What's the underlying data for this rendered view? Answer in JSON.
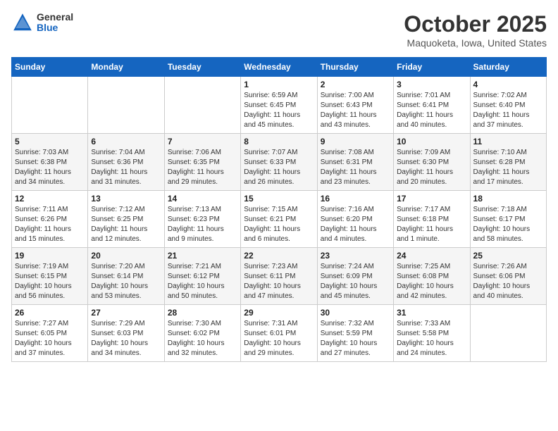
{
  "header": {
    "logo_general": "General",
    "logo_blue": "Blue",
    "month_title": "October 2025",
    "location": "Maquoketa, Iowa, United States"
  },
  "days_of_week": [
    "Sunday",
    "Monday",
    "Tuesday",
    "Wednesday",
    "Thursday",
    "Friday",
    "Saturday"
  ],
  "weeks": [
    [
      {
        "day": "",
        "info": ""
      },
      {
        "day": "",
        "info": ""
      },
      {
        "day": "",
        "info": ""
      },
      {
        "day": "1",
        "info": "Sunrise: 6:59 AM\nSunset: 6:45 PM\nDaylight: 11 hours\nand 45 minutes."
      },
      {
        "day": "2",
        "info": "Sunrise: 7:00 AM\nSunset: 6:43 PM\nDaylight: 11 hours\nand 43 minutes."
      },
      {
        "day": "3",
        "info": "Sunrise: 7:01 AM\nSunset: 6:41 PM\nDaylight: 11 hours\nand 40 minutes."
      },
      {
        "day": "4",
        "info": "Sunrise: 7:02 AM\nSunset: 6:40 PM\nDaylight: 11 hours\nand 37 minutes."
      }
    ],
    [
      {
        "day": "5",
        "info": "Sunrise: 7:03 AM\nSunset: 6:38 PM\nDaylight: 11 hours\nand 34 minutes."
      },
      {
        "day": "6",
        "info": "Sunrise: 7:04 AM\nSunset: 6:36 PM\nDaylight: 11 hours\nand 31 minutes."
      },
      {
        "day": "7",
        "info": "Sunrise: 7:06 AM\nSunset: 6:35 PM\nDaylight: 11 hours\nand 29 minutes."
      },
      {
        "day": "8",
        "info": "Sunrise: 7:07 AM\nSunset: 6:33 PM\nDaylight: 11 hours\nand 26 minutes."
      },
      {
        "day": "9",
        "info": "Sunrise: 7:08 AM\nSunset: 6:31 PM\nDaylight: 11 hours\nand 23 minutes."
      },
      {
        "day": "10",
        "info": "Sunrise: 7:09 AM\nSunset: 6:30 PM\nDaylight: 11 hours\nand 20 minutes."
      },
      {
        "day": "11",
        "info": "Sunrise: 7:10 AM\nSunset: 6:28 PM\nDaylight: 11 hours\nand 17 minutes."
      }
    ],
    [
      {
        "day": "12",
        "info": "Sunrise: 7:11 AM\nSunset: 6:26 PM\nDaylight: 11 hours\nand 15 minutes."
      },
      {
        "day": "13",
        "info": "Sunrise: 7:12 AM\nSunset: 6:25 PM\nDaylight: 11 hours\nand 12 minutes."
      },
      {
        "day": "14",
        "info": "Sunrise: 7:13 AM\nSunset: 6:23 PM\nDaylight: 11 hours\nand 9 minutes."
      },
      {
        "day": "15",
        "info": "Sunrise: 7:15 AM\nSunset: 6:21 PM\nDaylight: 11 hours\nand 6 minutes."
      },
      {
        "day": "16",
        "info": "Sunrise: 7:16 AM\nSunset: 6:20 PM\nDaylight: 11 hours\nand 4 minutes."
      },
      {
        "day": "17",
        "info": "Sunrise: 7:17 AM\nSunset: 6:18 PM\nDaylight: 11 hours\nand 1 minute."
      },
      {
        "day": "18",
        "info": "Sunrise: 7:18 AM\nSunset: 6:17 PM\nDaylight: 10 hours\nand 58 minutes."
      }
    ],
    [
      {
        "day": "19",
        "info": "Sunrise: 7:19 AM\nSunset: 6:15 PM\nDaylight: 10 hours\nand 56 minutes."
      },
      {
        "day": "20",
        "info": "Sunrise: 7:20 AM\nSunset: 6:14 PM\nDaylight: 10 hours\nand 53 minutes."
      },
      {
        "day": "21",
        "info": "Sunrise: 7:21 AM\nSunset: 6:12 PM\nDaylight: 10 hours\nand 50 minutes."
      },
      {
        "day": "22",
        "info": "Sunrise: 7:23 AM\nSunset: 6:11 PM\nDaylight: 10 hours\nand 47 minutes."
      },
      {
        "day": "23",
        "info": "Sunrise: 7:24 AM\nSunset: 6:09 PM\nDaylight: 10 hours\nand 45 minutes."
      },
      {
        "day": "24",
        "info": "Sunrise: 7:25 AM\nSunset: 6:08 PM\nDaylight: 10 hours\nand 42 minutes."
      },
      {
        "day": "25",
        "info": "Sunrise: 7:26 AM\nSunset: 6:06 PM\nDaylight: 10 hours\nand 40 minutes."
      }
    ],
    [
      {
        "day": "26",
        "info": "Sunrise: 7:27 AM\nSunset: 6:05 PM\nDaylight: 10 hours\nand 37 minutes."
      },
      {
        "day": "27",
        "info": "Sunrise: 7:29 AM\nSunset: 6:03 PM\nDaylight: 10 hours\nand 34 minutes."
      },
      {
        "day": "28",
        "info": "Sunrise: 7:30 AM\nSunset: 6:02 PM\nDaylight: 10 hours\nand 32 minutes."
      },
      {
        "day": "29",
        "info": "Sunrise: 7:31 AM\nSunset: 6:01 PM\nDaylight: 10 hours\nand 29 minutes."
      },
      {
        "day": "30",
        "info": "Sunrise: 7:32 AM\nSunset: 5:59 PM\nDaylight: 10 hours\nand 27 minutes."
      },
      {
        "day": "31",
        "info": "Sunrise: 7:33 AM\nSunset: 5:58 PM\nDaylight: 10 hours\nand 24 minutes."
      },
      {
        "day": "",
        "info": ""
      }
    ]
  ]
}
